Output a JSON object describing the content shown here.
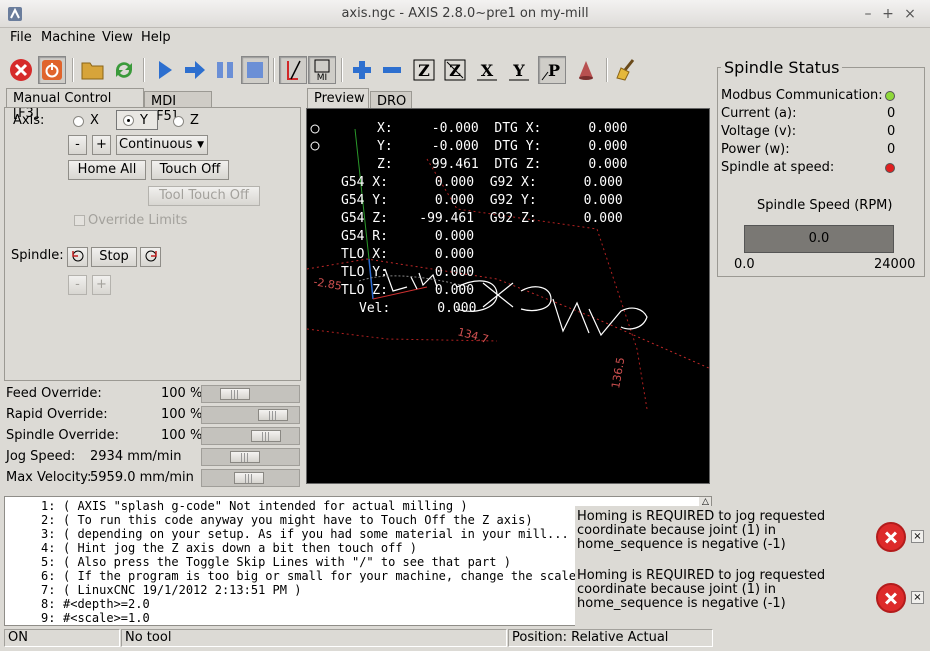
{
  "window": {
    "title": "axis.ngc - AXIS 2.8.0~pre1 on my-mill",
    "controls": [
      "–",
      "+",
      "×"
    ]
  },
  "menu": [
    "File",
    "Machine",
    "View",
    "Help"
  ],
  "toolbar": {
    "icons": [
      "estop-icon",
      "power-icon",
      "open-file-icon",
      "reload-icon",
      "run-icon",
      "step-icon",
      "pause-icon",
      "stop-icon",
      "toggle-skip-icon",
      "optional-stop-icon",
      "zoom-in-icon",
      "zoom-out-icon",
      "view-z-icon",
      "view-z2-icon",
      "view-x-icon",
      "view-y-icon",
      "view-p-icon",
      "rotate-icon",
      "clear-plot-icon"
    ],
    "view_labels": {
      "z": "Z",
      "z2": "Z",
      "x": "X",
      "y": "Y",
      "p": "P",
      "mi": "MI"
    }
  },
  "manual": {
    "tabs": [
      "Manual Control [F3]",
      "MDI [F5]"
    ],
    "axis_label": "Axis:",
    "axes": [
      "X",
      "Y",
      "Z"
    ],
    "selected_axis": "Y",
    "minus": "-",
    "plus": "+",
    "jog_mode": "Continuous",
    "home_all": "Home All",
    "touch_off": "Touch Off",
    "tool_touch_off": "Tool Touch Off",
    "override_limits": "Override Limits",
    "spindle_label": "Spindle:",
    "spindle_stop": "Stop"
  },
  "overrides": [
    {
      "label": "Feed Override:",
      "value": "100 %",
      "level": 0.25
    },
    {
      "label": "Rapid Override:",
      "value": "100 %",
      "level": 0.86
    },
    {
      "label": "Spindle Override:",
      "value": "100 %",
      "level": 0.74
    },
    {
      "label": "Jog Speed:",
      "value": "2934 mm/min",
      "level": 0.42
    },
    {
      "label": "Max Velocity:",
      "value": "5959.0 mm/min",
      "level": 0.48
    }
  ],
  "preview": {
    "tabs": [
      "Preview",
      "DRO"
    ],
    "dro": [
      "X:     -0.000  DTG X:      0.000",
      "Y:     -0.000  DTG Y:      0.000",
      "Z:     99.461  DTG Z:      0.000",
      "G54 X:      0.000  G92 X:      0.000",
      "G54 Y:      0.000  G92 Y:      0.000",
      "G54 Z:    -99.461  G92 Z:      0.000",
      "G54 R:      0.000",
      "TLO X:      0.000",
      "TLO Y:      0.000",
      "TLO Z:      0.000",
      "Vel:      0.000"
    ],
    "dims": [
      "134.7",
      "136.5",
      "-2.85"
    ]
  },
  "spindle_status": {
    "title": "Spindle Status",
    "rows": [
      {
        "label": "Modbus Communication:",
        "value": "",
        "indicator": "#8fd93a"
      },
      {
        "label": "Current (a):",
        "value": "0"
      },
      {
        "label": "Voltage (v):",
        "value": "0"
      },
      {
        "label": "Power (w):",
        "value": "0"
      },
      {
        "label": "Spindle at speed:",
        "value": "",
        "indicator": "#e01f1f"
      }
    ],
    "speed_label": "Spindle Speed (RPM)",
    "speed_value": "0.0",
    "range_min": "0.0",
    "range_max": "24000"
  },
  "gcode": [
    {
      "num": "1:",
      "text": "( AXIS \"splash g-code\" Not intended for actual milling )"
    },
    {
      "num": "2:",
      "text": "( To run this code anyway you might have to Touch Off the Z axis)"
    },
    {
      "num": "3:",
      "text": "( depending on your setup. As if you had some material in your mill... )"
    },
    {
      "num": "4:",
      "text": "( Hint jog the Z axis down a bit then touch off )"
    },
    {
      "num": "5:",
      "text": "( Also press the Toggle Skip Lines with \"/\" to see that part )"
    },
    {
      "num": "6:",
      "text": "( If the program is too big or small for your machine, change the scale b"
    },
    {
      "num": "7:",
      "text": "( LinuxCNC 19/1/2012 2:13:51 PM )"
    },
    {
      "num": "8:",
      "text": "#<depth>=2.0"
    },
    {
      "num": "9:",
      "text": "#<scale>=1.0"
    }
  ],
  "errors": [
    "Homing is REQUIRED to jog requested coordinate because joint (1) in home_sequence is negative (-1)",
    "Homing is REQUIRED to jog requested coordinate because joint (1) in home_sequence is negative (-1)"
  ],
  "status": {
    "state": "ON",
    "tool": "No tool",
    "position": "Position: Relative Actual"
  }
}
